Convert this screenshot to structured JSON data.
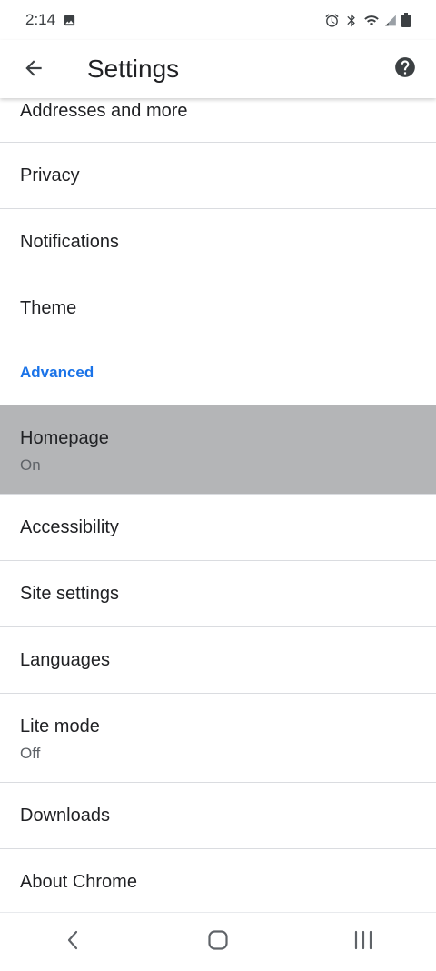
{
  "status_bar": {
    "time": "2:14"
  },
  "app_bar": {
    "title": "Settings"
  },
  "settings": {
    "addresses": "Addresses and more",
    "privacy": "Privacy",
    "notifications": "Notifications",
    "theme": "Theme",
    "advanced_header": "Advanced",
    "homepage": {
      "label": "Homepage",
      "status": "On"
    },
    "accessibility": "Accessibility",
    "site_settings": "Site settings",
    "languages": "Languages",
    "lite_mode": {
      "label": "Lite mode",
      "status": "Off"
    },
    "downloads": "Downloads",
    "about": "About Chrome"
  },
  "colors": {
    "accent": "#1a73e8",
    "highlight": "#b4b5b7",
    "divider": "#dadce0"
  },
  "icons": [
    "image-icon",
    "alarm-icon",
    "bluetooth-icon",
    "wifi-icon",
    "signal-icon",
    "battery-icon",
    "back-arrow-icon",
    "help-icon",
    "nav-back-icon",
    "nav-home-icon",
    "nav-recents-icon"
  ]
}
